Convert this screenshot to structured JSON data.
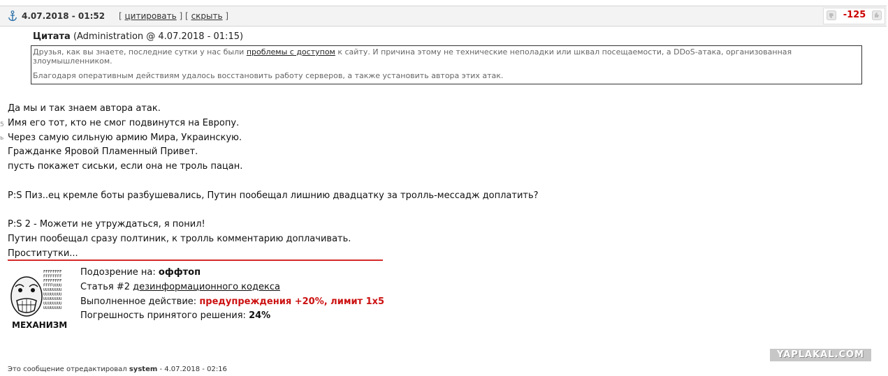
{
  "header": {
    "date": "4.07.2018 - 01:52",
    "bracket_open_1": "[",
    "quote_link": "цитировать",
    "bracket_mid": "] [",
    "hide_link": "скрыть",
    "bracket_close": "]",
    "rating": "-125"
  },
  "quote": {
    "label": "Цитата",
    "meta": "(Administration @ 4.07.2018 - 01:15)",
    "text_before_link": "Друзья, как вы знаете, последние сутки у нас были ",
    "link_text": "проблемы с доступом",
    "text_after_link": " к сайту. И причина этому не технические неполадки или шквал посещаемости, а DDoS-атака, организованная злоумышленником.",
    "second_paragraph": "Благодаря оперативным действиям удалось восстановить работу серверов, а также установить автора этих атак."
  },
  "body_lines": [
    "Да мы и так знаем автора атак.",
    "Имя его тот, кто не смог подвинутся на Европу.",
    "Через самую сильную армию Мира, Украинскую.",
    "Гражданке Яровой Пламенный Привет.",
    "пусть покажет сиськи, если она не троль пацан.",
    "",
    "P:S Пиз..ец кремле боты разбушевались, Путин пообещал лишнию двадцатку за тролль-мессадж доплатить?",
    "",
    "P:S 2 - Можети не утруждаться, я понил!",
    "Путин пообещал сразу полтиник, к тролль комментарию доплачивать.",
    "Проститутки..."
  ],
  "verdict": {
    "mechanism_label": "МЕХАНИЗМ",
    "meme_text": "FFFFFFFFFFFFFFFFFFFFUUUUUUUUUUUUUUUUUUUUUUUU",
    "suspicion_label": "Подозрение на: ",
    "suspicion_value": "оффтоп",
    "article_label": "Статья #2 ",
    "article_link": "дезинформационного кодекса",
    "action_label": "Выполненное действие: ",
    "action_value": "предупреждения +20%, лимит 1x5",
    "error_label": "Погрешность принятого решения: ",
    "error_value": "24%"
  },
  "watermark": "YAPLAKAL.COM",
  "edited": {
    "prefix": "Это сообщение отредактировал ",
    "user": "system",
    "suffix": " - 4.07.2018 - 02:16"
  },
  "left_marks": [
    "5",
    "ь"
  ],
  "icons": {
    "anchor": "anchor-icon",
    "vote_down": "thumb-down-icon",
    "vote_up": "thumb-up-icon"
  },
  "colors": {
    "rating": "#cc0000",
    "divider": "#d42a2a",
    "action": "#cc1111"
  }
}
